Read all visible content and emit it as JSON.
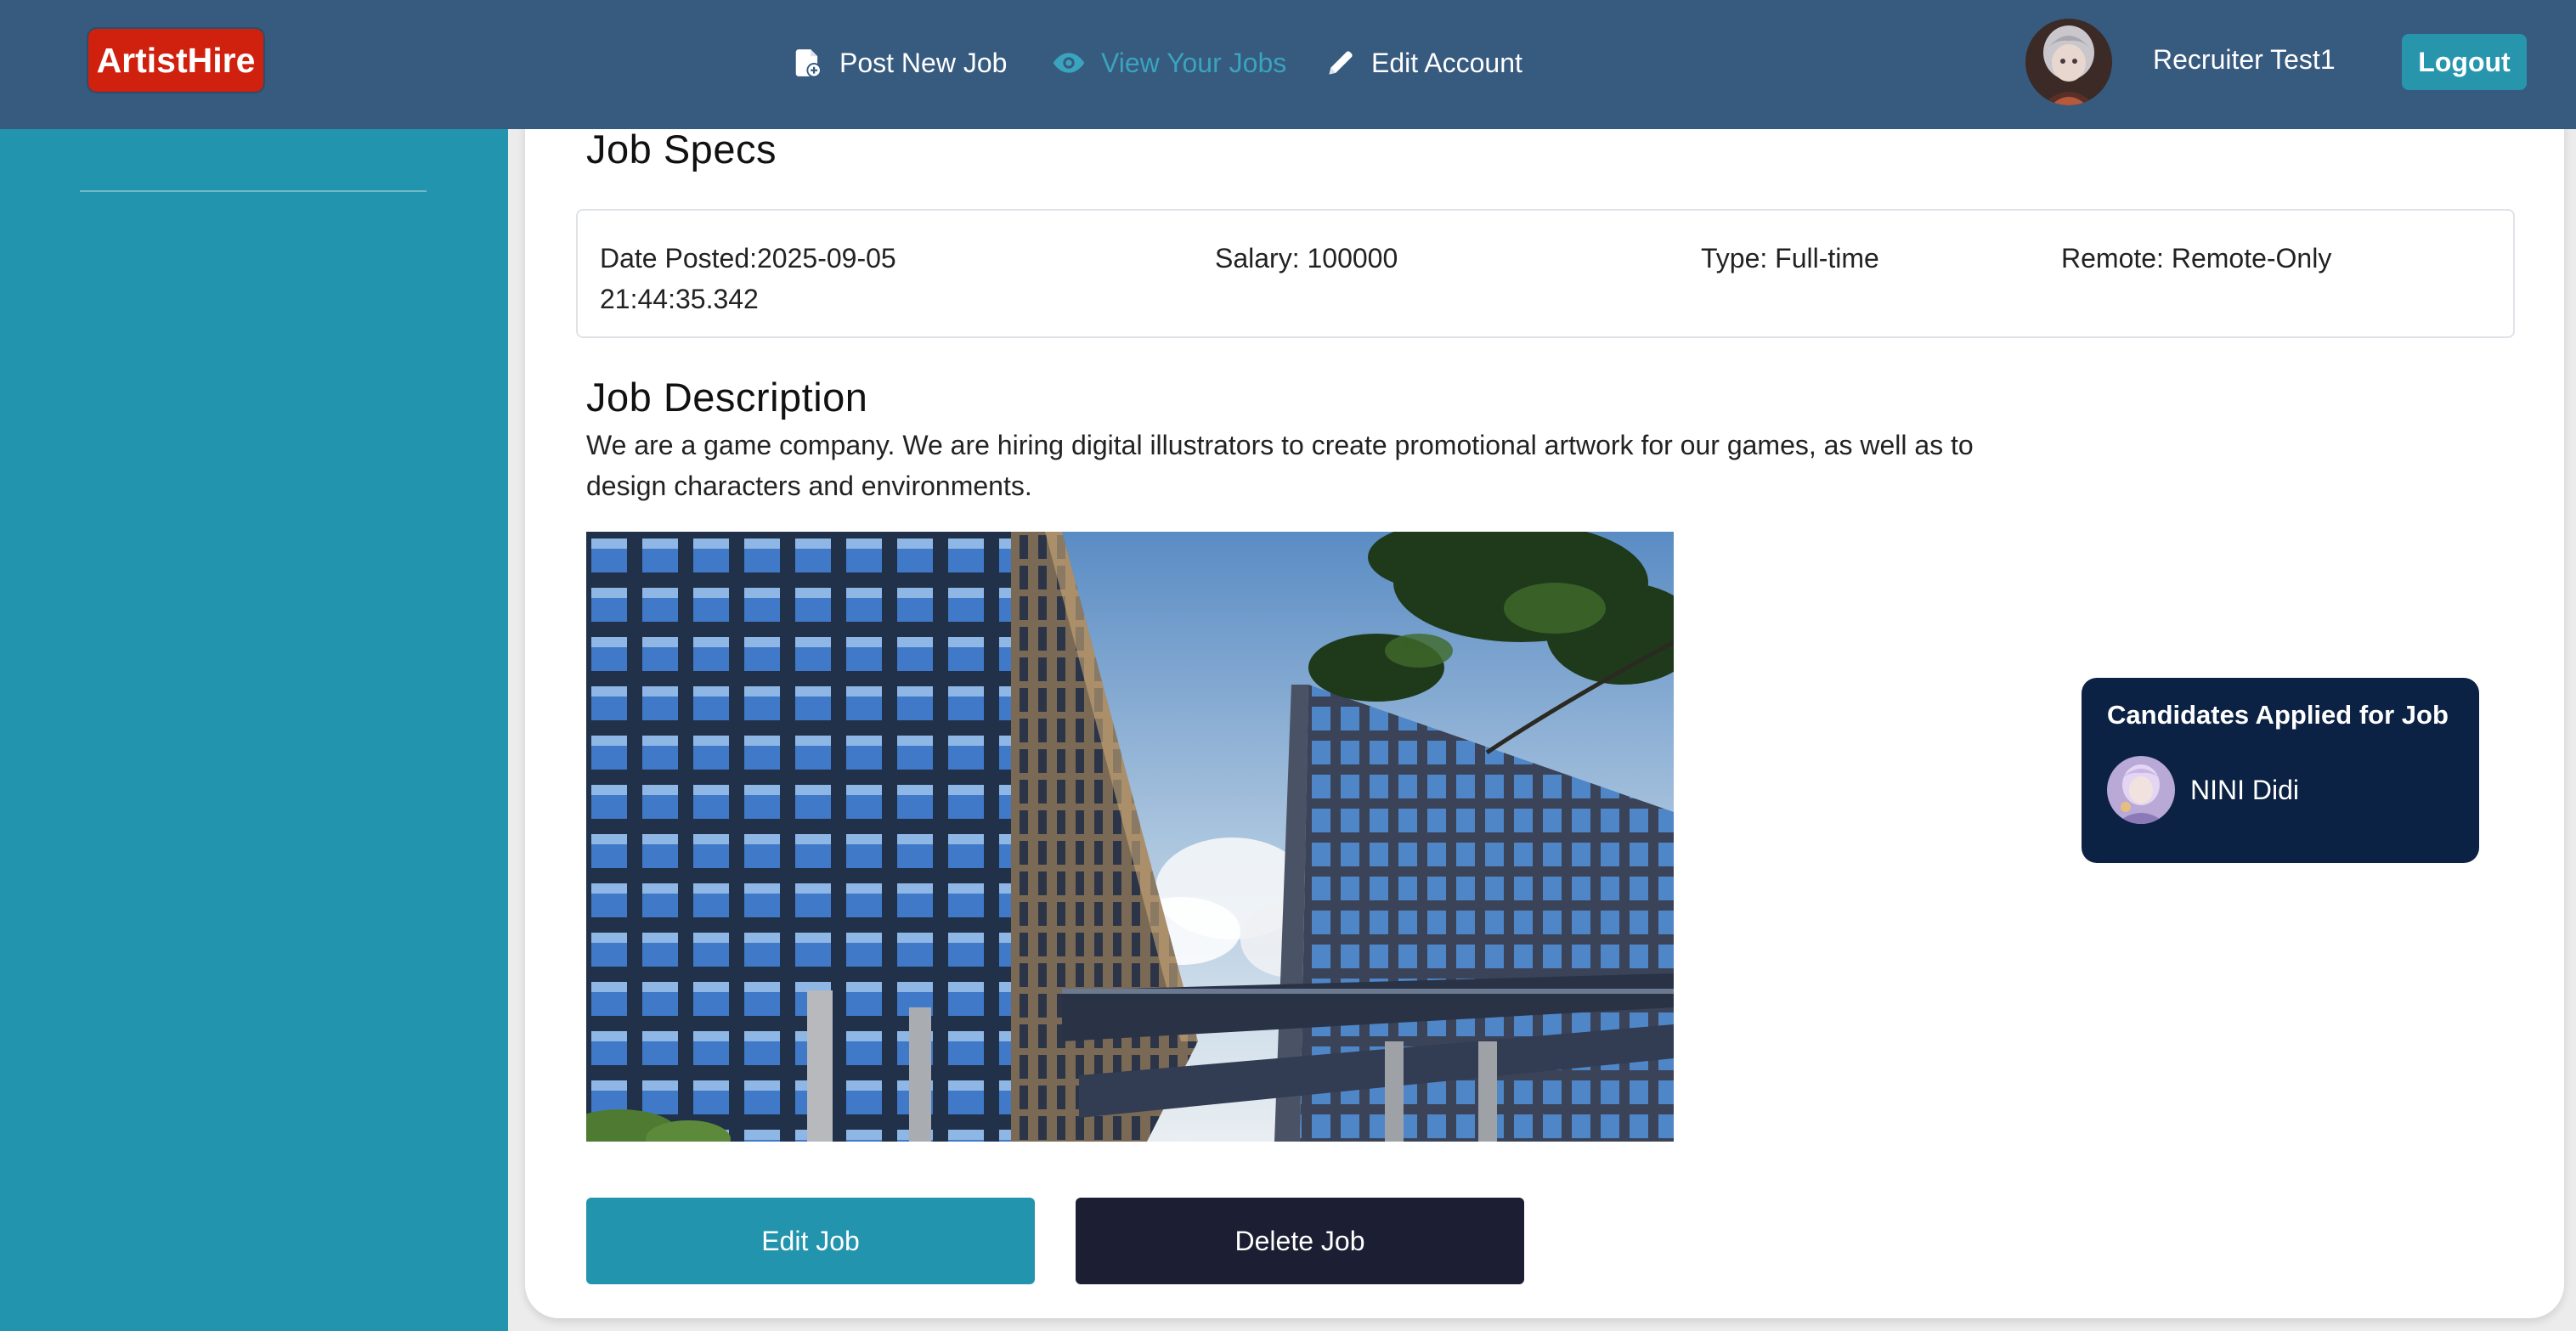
{
  "header": {
    "logo": "ArtistHire",
    "nav": {
      "post_new_job": "Post New Job",
      "view_your_jobs": "View Your Jobs",
      "edit_account": "Edit Account"
    },
    "user_name": "Recruiter Test1",
    "logout_label": "Logout"
  },
  "job": {
    "specs_title": "Job Specs",
    "date_posted": "Date Posted:2025-09-05 21:44:35.342",
    "salary": "Salary: 100000",
    "type": "Type: Full-time",
    "remote": "Remote: Remote-Only",
    "description_title": "Job Description",
    "description": "We are a game company. We are hiring digital illustrators to create promotional artwork for our games, as well as to design characters and environments.",
    "edit_label": "Edit Job",
    "delete_label": "Delete Job"
  },
  "candidates": {
    "title": "Candidates Applied for Job",
    "items": [
      {
        "name": "NINI Didi"
      }
    ]
  },
  "colors": {
    "header_bg": "#375a7f",
    "logo_bg": "#d0200e",
    "sidebar_bg": "#2394ad",
    "active_nav": "#3aa3bd",
    "edit_button": "#2394ad",
    "delete_button": "#1c1f33",
    "candidates_bg": "#0c2244"
  },
  "icons": {
    "post_new_job": "file-plus-icon",
    "view_your_jobs": "eye-icon",
    "edit_account": "pencil-icon"
  }
}
